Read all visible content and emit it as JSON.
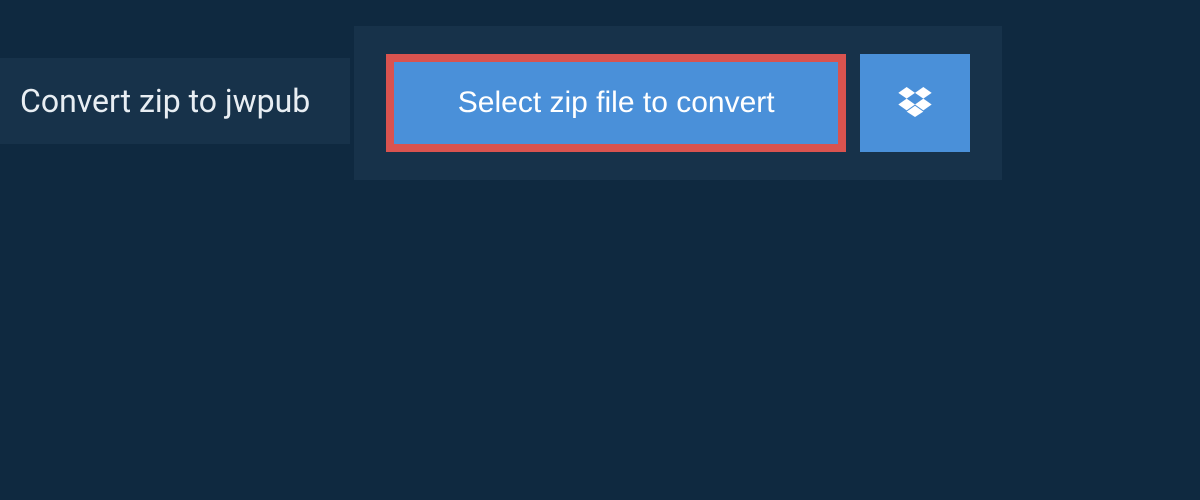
{
  "header": {
    "title": "Convert zip to jwpub"
  },
  "actions": {
    "select_label": "Select zip file to convert"
  },
  "colors": {
    "background": "#0f2940",
    "panel": "#17324a",
    "button": "#4a90d9",
    "highlight_border": "#d9534f",
    "text_light": "#e8eef3",
    "text_white": "#ffffff"
  }
}
